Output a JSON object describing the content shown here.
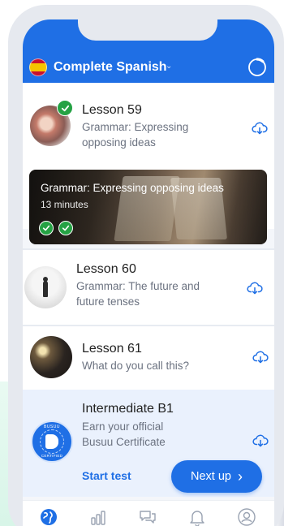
{
  "header": {
    "course_title": "Complete Spanish",
    "course_chevron": "⌄",
    "progress_fraction": 0.12
  },
  "lessons": [
    {
      "title": "Lesson 59",
      "subtitle": "Grammar: Expressing opposing ideas",
      "completed": true,
      "thumb_icon": "lesson-59-photo"
    },
    {
      "title": "Lesson 60",
      "subtitle": "Grammar: The future and future tenses",
      "thumb_icon": "lesson-60-photo"
    },
    {
      "title": "Lesson 61",
      "subtitle": "What do you call this?",
      "thumb_icon": "lesson-61-photo"
    }
  ],
  "activity": {
    "title": "Grammar: Expressing opposing ideas",
    "duration": "13 minutes",
    "checks_completed": 2
  },
  "certificate": {
    "title": "Intermediate B1",
    "subtitle": "Earn your official Busuu Certificate",
    "badge_top": "BUSUU",
    "badge_bottom": "CERTIFIED",
    "start_test": "Start test",
    "next_up": "Next up",
    "next_up_chevron": "›"
  },
  "tabs": [
    "learn-icon",
    "review-icon",
    "community-icon",
    "notifications-icon",
    "profile-icon"
  ],
  "colors": {
    "brand_blue": "#1f6fe5",
    "check_green": "#25a244",
    "cert_bg": "#eaf1fd"
  }
}
